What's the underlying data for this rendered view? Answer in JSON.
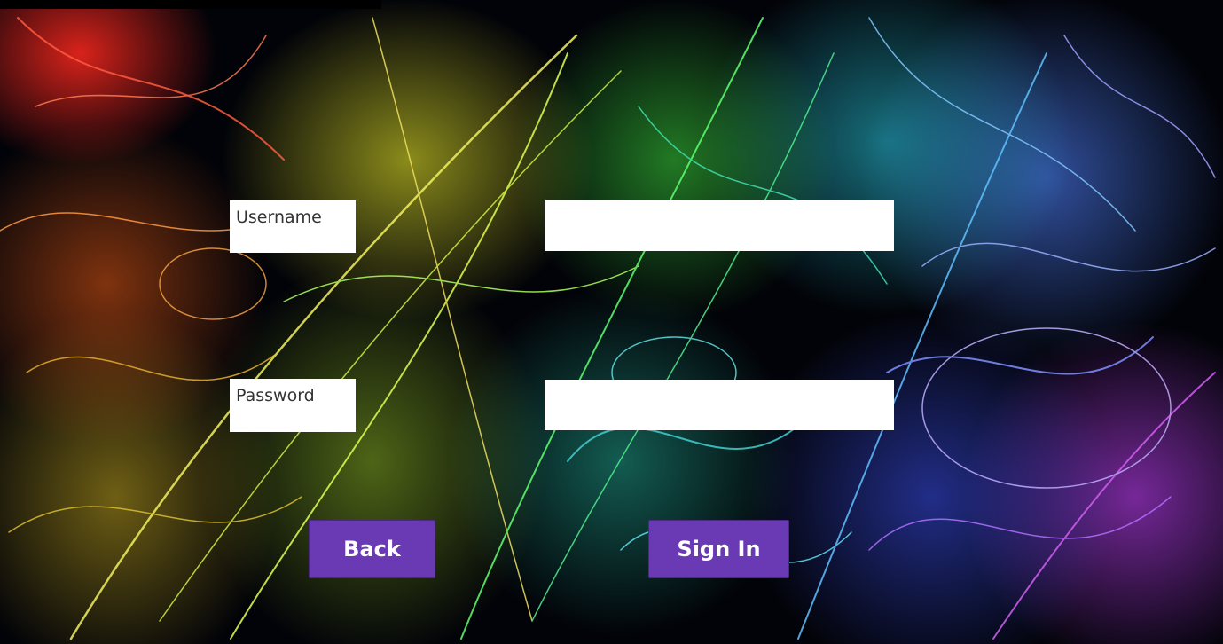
{
  "form": {
    "username": {
      "label": "Username",
      "value": "",
      "placeholder": ""
    },
    "password": {
      "label": "Password",
      "value": "",
      "placeholder": ""
    }
  },
  "buttons": {
    "back_label": "Back",
    "signin_label": "Sign In"
  },
  "colors": {
    "button_bg": "#6a3ab4",
    "field_bg": "#ffffff",
    "label_text": "#333333"
  }
}
